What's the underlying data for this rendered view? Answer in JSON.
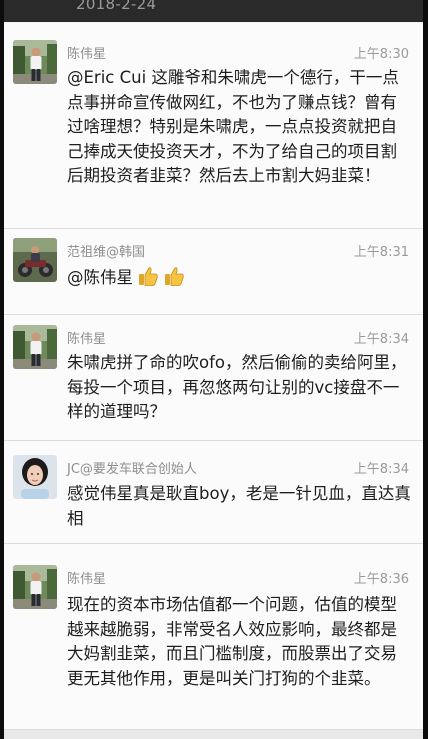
{
  "status_bar": {
    "date": "2018-2-24"
  },
  "messages": [
    {
      "sender": "陈伟星",
      "time": "上午8:30",
      "text": "@Eric Cui 这雕爷和朱啸虎一个德行，干一点点事拼命宣传做网红，不也为了赚点钱？曾有过啥理想？特别是朱啸虎，一点点投资就把自己捧成天使投资天才，不为了给自己的项目割后期投资者韭菜？然后去上市割大妈韭菜！",
      "avatar_icon": "man-standing-outdoors-avatar"
    },
    {
      "sender": "范祖维@韩国",
      "time": "上午8:31",
      "text": "@陈伟星",
      "emojis": [
        "thumbs-up-emoji",
        "thumbs-up-emoji"
      ],
      "avatar_icon": "motorcycle-photo-avatar"
    },
    {
      "sender": "陈伟星",
      "time": "上午8:34",
      "text": "朱啸虎拼了命的吹ofo，然后偷偷的卖给阿里，每投一个项目，再忽悠两句让别的vc接盘不一样的道理吗？",
      "avatar_icon": "man-standing-outdoors-avatar"
    },
    {
      "sender": "JC@要发车联合创始人",
      "time": "上午8:34",
      "text": "感觉伟星真是耿直boy，老是一针见血，直达真相",
      "avatar_icon": "woman-portrait-avatar"
    },
    {
      "sender": "陈伟星",
      "time": "上午8:36",
      "text": "现在的资本市场估值都一个问题，估值的模型越来越脆弱，非常受名人效应影响，最终都是大妈割韭菜，而且门槛制度，而股票出了交易更无其他作用，更是叫关门打狗的个韭菜。",
      "avatar_icon": "man-standing-outdoors-avatar"
    }
  ]
}
